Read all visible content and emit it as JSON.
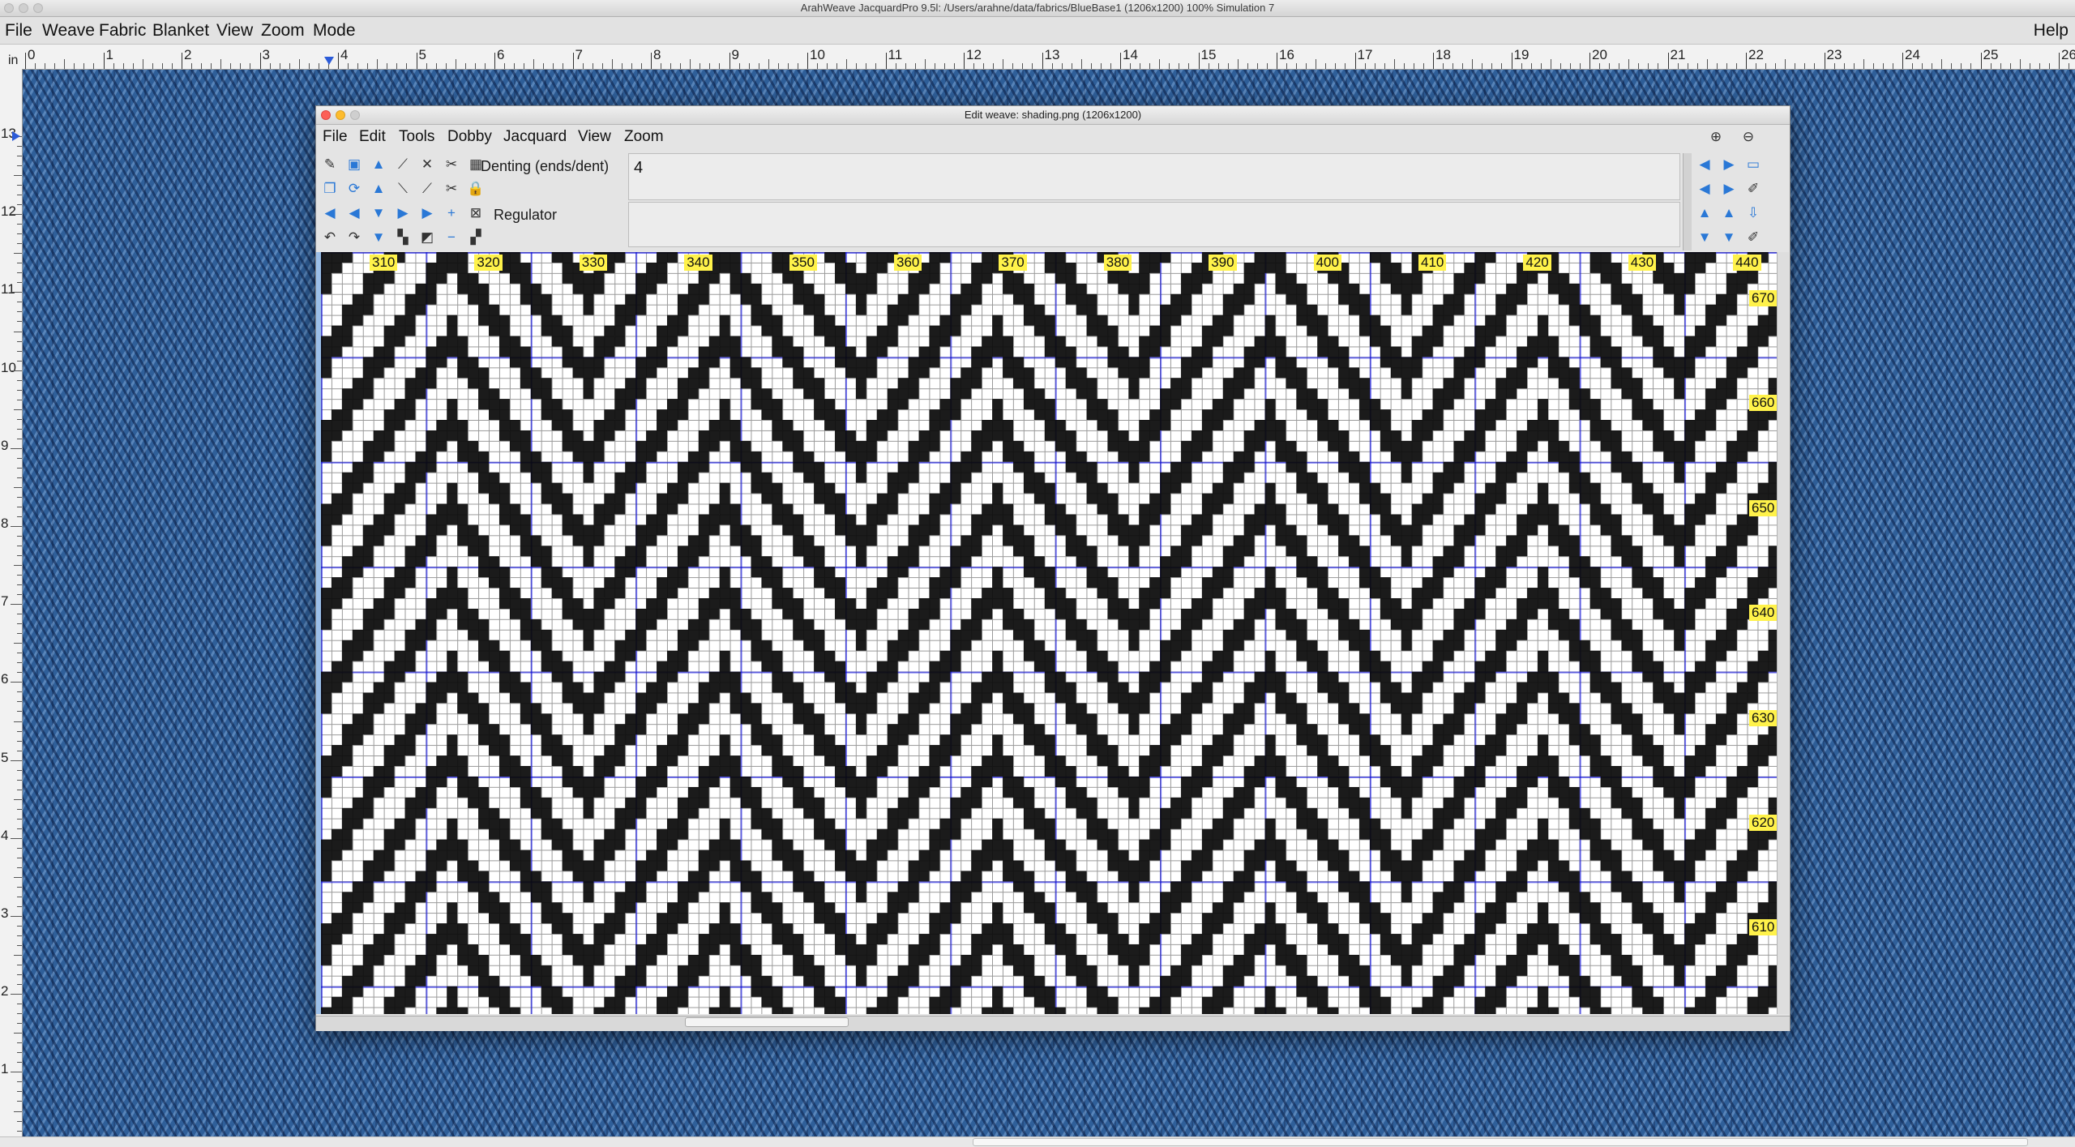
{
  "window": {
    "title": "ArahWeave JacquardPro 9.5l: /Users/arahne/data/fabrics/BlueBase1 (1206x1200) 100% Simulation 7"
  },
  "menubar": {
    "items": [
      "File",
      "Weave",
      "Fabric",
      "Blanket",
      "View",
      "Zoom",
      "Mode"
    ],
    "help": "Help"
  },
  "ruler": {
    "unit": "in",
    "top_ticks": [
      "0",
      "1",
      "2",
      "3",
      "4",
      "5",
      "6",
      "7",
      "8",
      "9",
      "10",
      "11",
      "12",
      "13",
      "14",
      "15",
      "16",
      "17",
      "18",
      "19",
      "20",
      "21",
      "22",
      "23",
      "24",
      "25",
      "26"
    ],
    "left_ticks": [
      "13",
      "12",
      "11",
      "10",
      "9",
      "8",
      "7",
      "6",
      "5",
      "4",
      "3",
      "2",
      "1"
    ]
  },
  "edit_weave": {
    "title": "Edit weave: shading.png (1206x1200)",
    "menu": [
      "File",
      "Edit",
      "Tools",
      "Dobby",
      "Jacquard",
      "View",
      "Zoom"
    ],
    "denting_label": "Denting (ends/dent)",
    "denting_value": "4",
    "regulator_label": "Regulator",
    "regulator_value": "",
    "column_labels": [
      "310",
      "320",
      "330",
      "340",
      "350",
      "360",
      "370",
      "380",
      "390",
      "400",
      "410",
      "420",
      "430",
      "440"
    ],
    "row_labels": [
      "670",
      "660",
      "650",
      "640",
      "630",
      "620",
      "610"
    ],
    "colors": {
      "grid_line": "#0000e6",
      "fabric_blue": "#2f5f99",
      "label_yellow": "#fff24a"
    }
  },
  "icons": {
    "left_toolbar": [
      "pencil-icon",
      "picture-icon",
      "arrow-up-icon",
      "diagonal-icon",
      "cross-icon",
      "scissors-icon",
      "pattern-icon",
      "copy-icon",
      "repeat-icon",
      "arrow-up-icon",
      "diagonal-down-icon",
      "diagonal-icon",
      "scissors-icon",
      "lock-icon",
      "arrow-double-left-icon",
      "arrow-left-icon",
      "arrow-down-icon",
      "arrow-right-icon",
      "arrow-double-right-icon",
      "plus-icon",
      "box-x-icon",
      "undo-icon",
      "redo-icon",
      "arrow-double-down-icon",
      "checker-icon",
      "slash-icon",
      "minus-icon",
      "checker-small-icon"
    ],
    "right_toolbar": [
      "zoom-in-icon",
      "zoom-out-icon",
      "arrow-left-icon",
      "arrow-right-icon",
      "screen-icon",
      "arrow-double-left-icon",
      "arrow-double-right-icon",
      "brush-icon",
      "arrow-up-icon",
      "arrow-double-up-icon",
      "export-icon",
      "arrow-down-icon",
      "arrow-double-down-icon",
      "brush-icon"
    ]
  }
}
